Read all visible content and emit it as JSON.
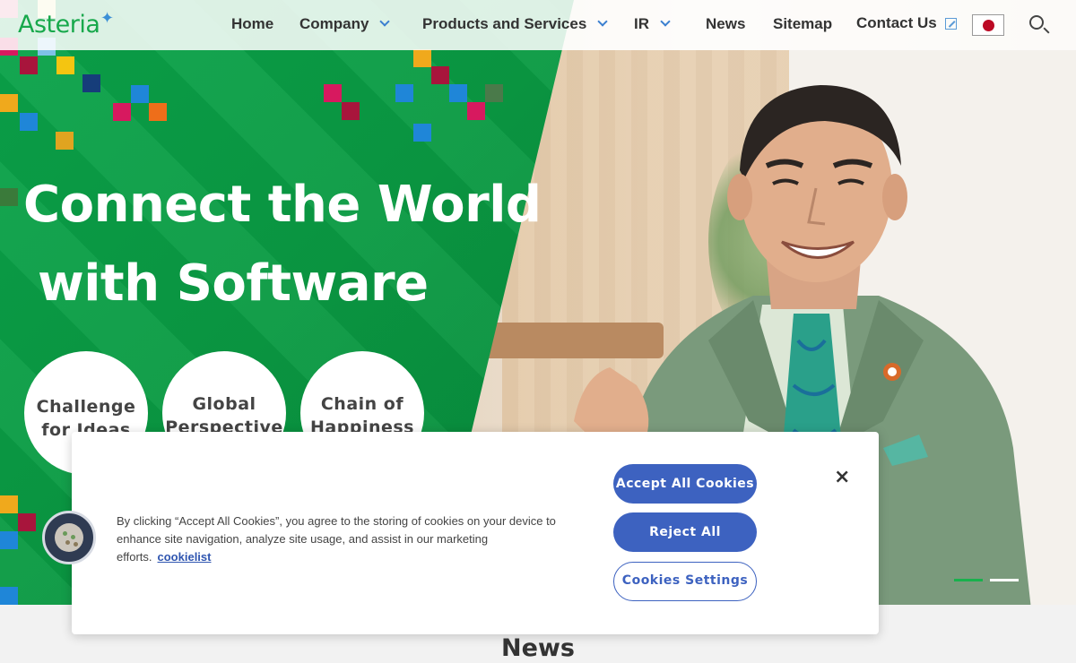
{
  "header": {
    "logo": "Asteria",
    "nav": {
      "home": "Home",
      "company": "Company",
      "products": "Products and Services",
      "ir": "IR",
      "news": "News",
      "sitemap": "Sitemap",
      "contact": "Contact Us"
    },
    "language_icon": "japan-flag-icon",
    "search_icon": "search-icon"
  },
  "hero": {
    "headline_line1": "Connect the World",
    "headline_line2": "with Software",
    "circles": [
      {
        "line1": "Challenge",
        "line2": "for Ideas"
      },
      {
        "line1": "Global",
        "line2": "Perspective"
      },
      {
        "line1": "Chain of",
        "line2": "Happiness"
      }
    ],
    "slider": {
      "active_index": 0,
      "count": 2
    }
  },
  "cookie_banner": {
    "text": "By clicking “Accept All Cookies”, you agree to the storing of cookies on your device to enhance site navigation, analyze site usage, and assist in our marketing efforts.",
    "link": "cookielist",
    "accept": "Accept All Cookies",
    "reject": "Reject All",
    "settings": "Cookies Settings",
    "close": "×"
  },
  "news": {
    "heading": "News"
  },
  "colors": {
    "brand_green": "#0aa34a",
    "button_blue": "#3d62c0",
    "logo_blue": "#3b8fd6"
  }
}
